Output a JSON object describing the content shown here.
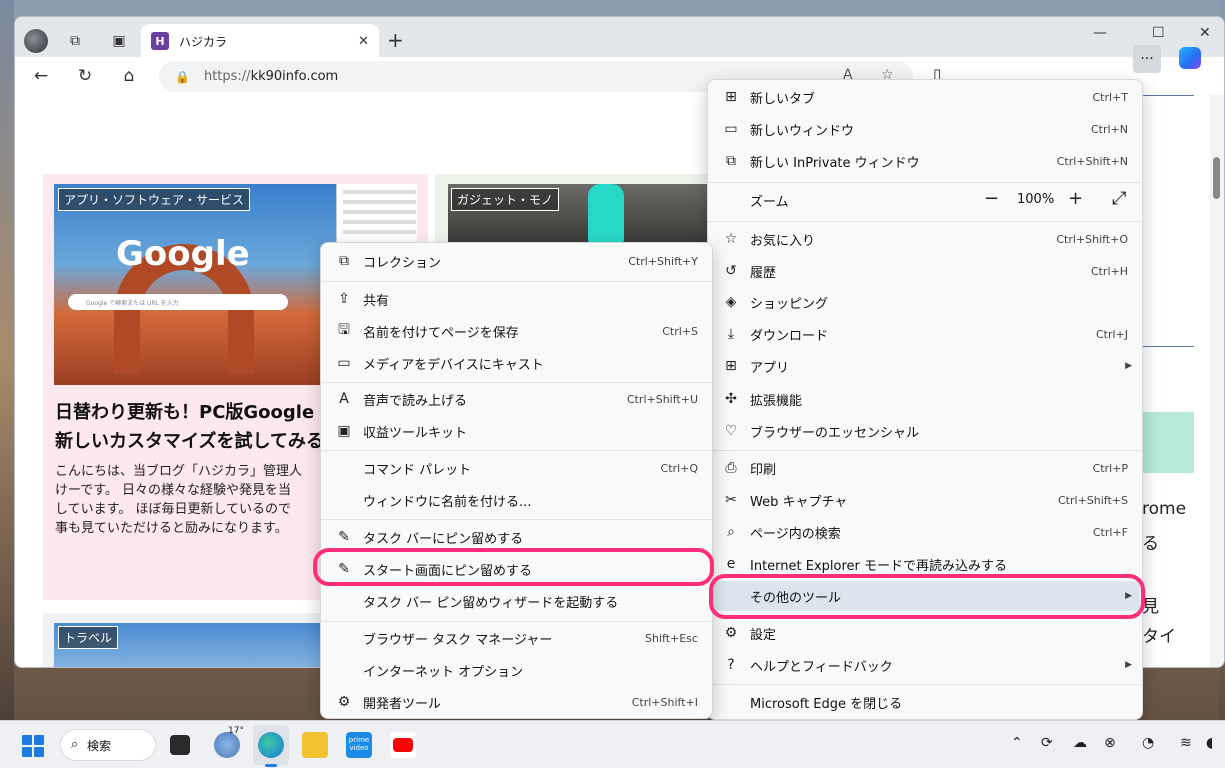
{
  "browser": {
    "tab_title": "ハジカラ",
    "tab_favicon": "H",
    "url_prefix": "https://",
    "url_host": "kk90info.com"
  },
  "page": {
    "card1": {
      "category": "アプリ・ソフトウェア・サービス",
      "title_line1": "日替わり更新も！PC版Google C",
      "title_line2": "新しいカスタマイズを試してみる",
      "excerpt": [
        "こんにちは、当ブログ「ハジカラ」管理人",
        "けーです。 日々の様々な経験や発見を当",
        "しています。 ほぼ毎日更新しているので",
        "事も見ていただけると励みになります。 "
      ],
      "google_logo": "Google",
      "google_search_placeholder": "Google で検索または URL を入力"
    },
    "card2": {
      "category": "ガジェット・モノ"
    },
    "card3": {
      "category": "トラベル"
    },
    "right_snippets": [
      "rome",
      "る",
      "見",
      "タイ"
    ]
  },
  "main_menu": {
    "items": [
      {
        "icon": "new-tab-icon",
        "label": "新しいタブ",
        "shortcut": "Ctrl+T"
      },
      {
        "icon": "new-window-icon",
        "label": "新しいウィンドウ",
        "shortcut": "Ctrl+N"
      },
      {
        "icon": "inprivate-icon",
        "label": "新しい InPrivate ウィンドウ",
        "shortcut": "Ctrl+Shift+N"
      },
      {
        "icon": "",
        "label": "ズーム",
        "shortcut": ""
      },
      {
        "icon": "favorites-icon",
        "label": "お気に入り",
        "shortcut": "Ctrl+Shift+O"
      },
      {
        "icon": "history-icon",
        "label": "履歴",
        "shortcut": "Ctrl+H"
      },
      {
        "icon": "shopping-icon",
        "label": "ショッピング",
        "shortcut": ""
      },
      {
        "icon": "download-icon",
        "label": "ダウンロード",
        "shortcut": "Ctrl+J"
      },
      {
        "icon": "apps-icon",
        "label": "アプリ",
        "shortcut": ""
      },
      {
        "icon": "extensions-icon",
        "label": "拡張機能",
        "shortcut": ""
      },
      {
        "icon": "browser-essentials-icon",
        "label": "ブラウザーのエッセンシャル",
        "shortcut": ""
      },
      {
        "icon": "print-icon",
        "label": "印刷",
        "shortcut": "Ctrl+P"
      },
      {
        "icon": "web-capture-icon",
        "label": "Web キャプチャ",
        "shortcut": "Ctrl+Shift+S"
      },
      {
        "icon": "find-icon",
        "label": "ページ内の検索",
        "shortcut": "Ctrl+F"
      },
      {
        "icon": "ie-icon",
        "label": "Internet Explorer モードで再読み込みする",
        "shortcut": ""
      },
      {
        "icon": "",
        "label": "その他のツール",
        "shortcut": ""
      },
      {
        "icon": "settings-icon",
        "label": "設定",
        "shortcut": ""
      },
      {
        "icon": "help-icon",
        "label": "ヘルプとフィードバック",
        "shortcut": ""
      },
      {
        "icon": "",
        "label": "Microsoft Edge を閉じる",
        "shortcut": ""
      }
    ],
    "zoom": {
      "minus": "−",
      "value": "100%",
      "plus": "+",
      "fullscreen": "⤢"
    }
  },
  "sub_menu": {
    "items": [
      {
        "icon": "collections-icon",
        "label": "コレクション",
        "shortcut": "Ctrl+Shift+Y"
      },
      {
        "icon": "share-icon",
        "label": "共有",
        "shortcut": ""
      },
      {
        "icon": "save-page-icon",
        "label": "名前を付けてページを保存",
        "shortcut": "Ctrl+S"
      },
      {
        "icon": "cast-icon",
        "label": "メディアをデバイスにキャスト",
        "shortcut": ""
      },
      {
        "icon": "read-aloud-icon",
        "label": "音声で読み上げる",
        "shortcut": "Ctrl+Shift+U"
      },
      {
        "icon": "monetization-icon",
        "label": "収益ツールキット",
        "shortcut": ""
      },
      {
        "icon": "",
        "label": "コマンド パレット",
        "shortcut": "Ctrl+Q"
      },
      {
        "icon": "",
        "label": "ウィンドウに名前を付ける...",
        "shortcut": ""
      },
      {
        "icon": "pin-icon",
        "label": "タスク バーにピン留めする",
        "shortcut": ""
      },
      {
        "icon": "pin-icon",
        "label": "スタート画面にピン留めする",
        "shortcut": ""
      },
      {
        "icon": "",
        "label": "タスク バー ピン留めウィザードを起動する",
        "shortcut": ""
      },
      {
        "icon": "",
        "label": "ブラウザー タスク マネージャー",
        "shortcut": "Shift+Esc"
      },
      {
        "icon": "",
        "label": "インターネット オプション",
        "shortcut": ""
      },
      {
        "icon": "dev-tools-icon",
        "label": "開発者ツール",
        "shortcut": "Ctrl+Shift+I"
      }
    ]
  },
  "taskbar": {
    "search_label": "検索",
    "weather_temp": "17°",
    "prime_label": "prime video"
  },
  "colors": {
    "highlight": "#ff2e7a",
    "accent": "#1c7ae0"
  }
}
